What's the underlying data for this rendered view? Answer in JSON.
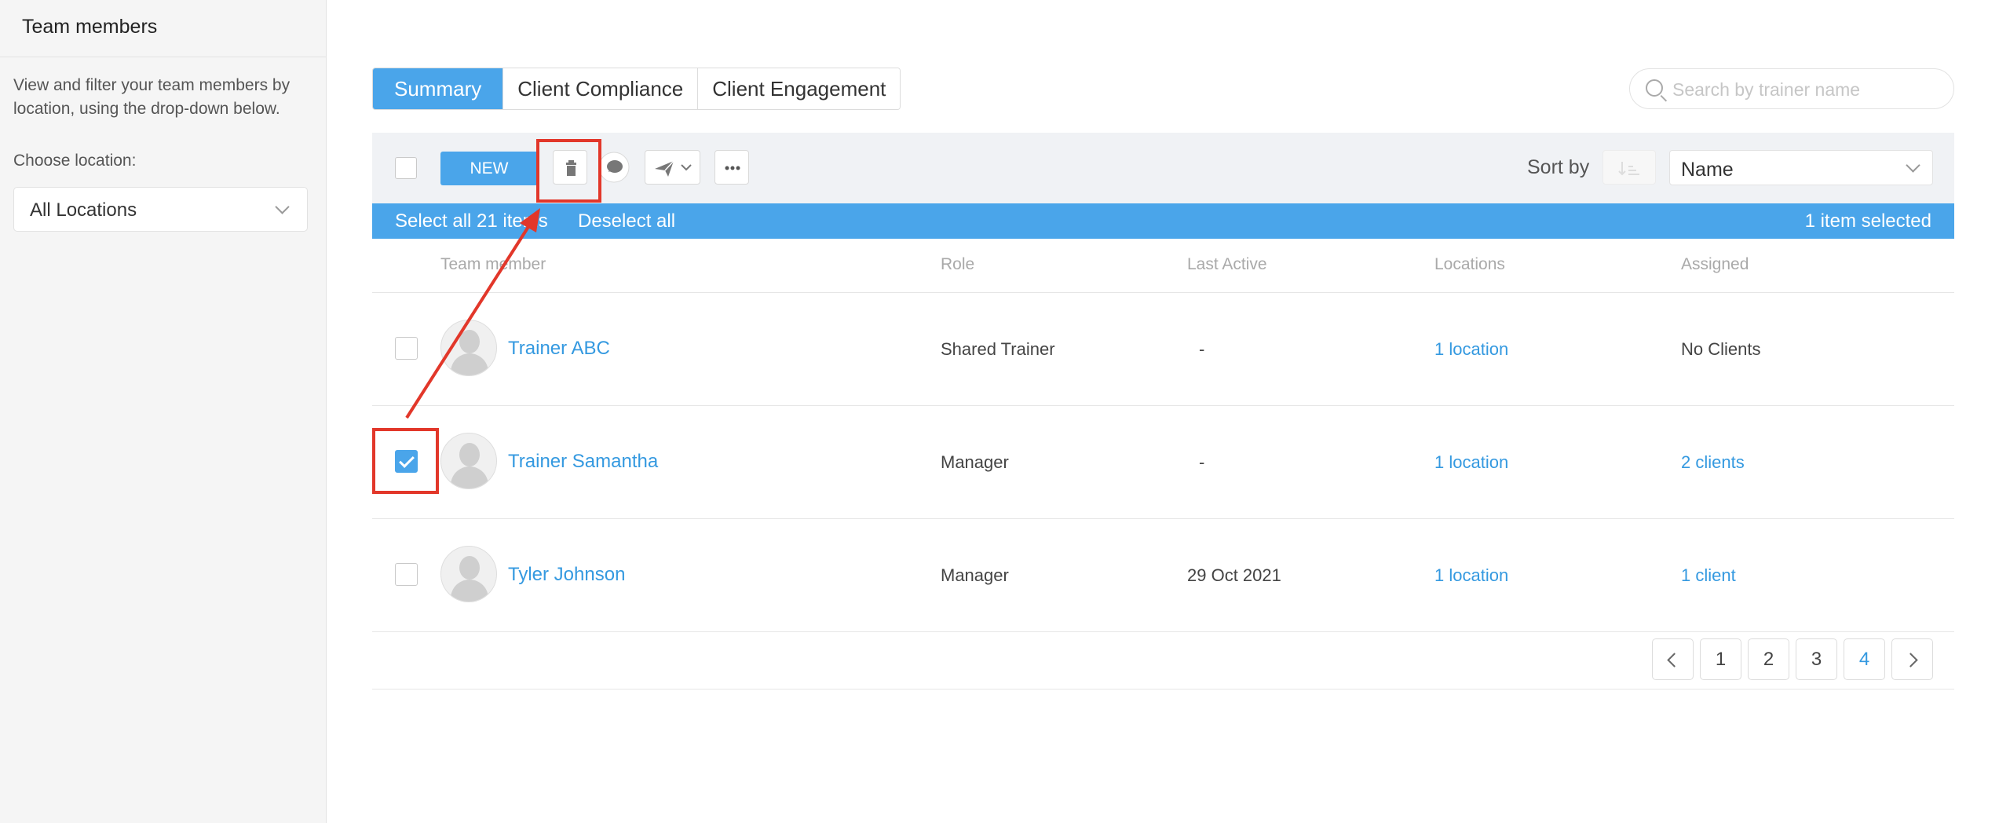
{
  "sidebar": {
    "title": "Team members",
    "description": "View and filter your team members by location, using the drop-down below.",
    "location_label": "Choose location:",
    "location_value": "All Locations"
  },
  "tabs": [
    {
      "label": "Summary",
      "active": true
    },
    {
      "label": "Client Compliance",
      "active": false
    },
    {
      "label": "Client Engagement",
      "active": false
    }
  ],
  "search": {
    "placeholder": "Search by trainer name"
  },
  "toolbar": {
    "new_label": "NEW",
    "sort_label": "Sort by",
    "sort_value": "Name"
  },
  "selection_bar": {
    "select_all": "Select all 21 items",
    "deselect_all": "Deselect all",
    "selected_count": "1 item selected"
  },
  "columns": [
    "Team member",
    "Role",
    "Last Active",
    "Locations",
    "Assigned"
  ],
  "rows": [
    {
      "name": "Trainer ABC",
      "role": "Shared Trainer",
      "last_active": "-",
      "locations": "1 location",
      "assigned": "No Clients",
      "assigned_is_link": false,
      "checked": false
    },
    {
      "name": "Trainer Samantha",
      "role": "Manager",
      "last_active": "-",
      "locations": "1 location",
      "assigned": "2 clients",
      "assigned_is_link": true,
      "checked": true
    },
    {
      "name": "Tyler Johnson",
      "role": "Manager",
      "last_active": "29 Oct 2021",
      "locations": "1 location",
      "assigned": "1 client",
      "assigned_is_link": true,
      "checked": false
    }
  ],
  "pagination": {
    "pages": [
      "1",
      "2",
      "3",
      "4"
    ],
    "current": "4"
  },
  "colors": {
    "accent": "#4aa5ea",
    "link": "#3499e0",
    "annotation": "#e2372a"
  }
}
